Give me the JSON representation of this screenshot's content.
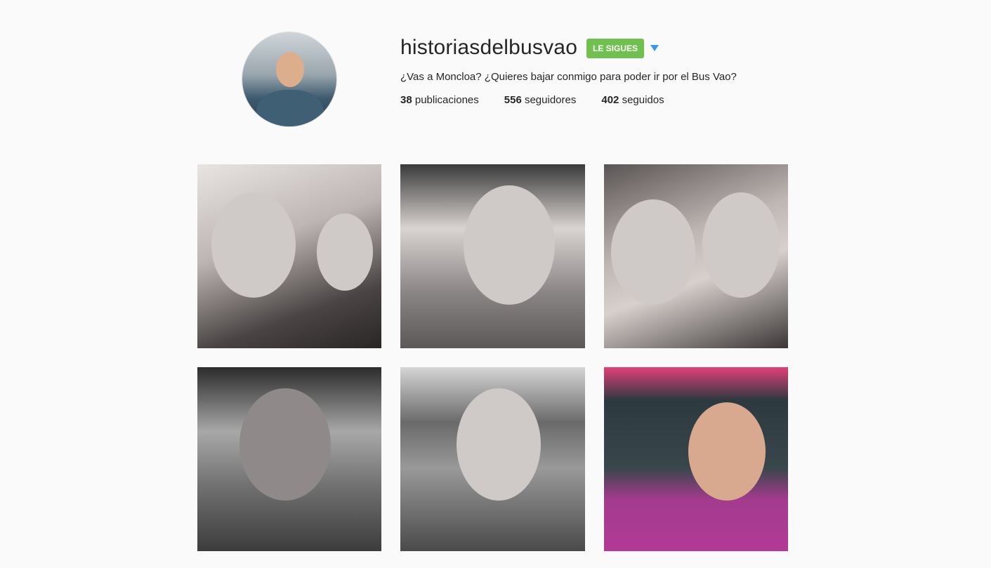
{
  "profile": {
    "username": "historiasdelbusvao",
    "follow_button_label": "LE SIGUES",
    "bio": "¿Vas a Moncloa? ¿Quieres bajar conmigo para poder ir por el Bus Vao?",
    "stats": {
      "posts_count": "38",
      "posts_label": "publicaciones",
      "followers_count": "556",
      "followers_label": "seguidores",
      "following_count": "402",
      "following_label": "seguidos"
    },
    "accent_colors": {
      "follow_button": "#70c050",
      "dropdown_arrow": "#3897f0"
    }
  },
  "posts": [
    {
      "kind": "photo",
      "description_icon": "selfie-photo"
    },
    {
      "kind": "photo",
      "description_icon": "selfie-photo"
    },
    {
      "kind": "photo",
      "description_icon": "selfie-photo"
    },
    {
      "kind": "photo",
      "description_icon": "selfie-photo"
    },
    {
      "kind": "photo",
      "description_icon": "selfie-photo"
    },
    {
      "kind": "photo",
      "description_icon": "selfie-photo"
    }
  ]
}
